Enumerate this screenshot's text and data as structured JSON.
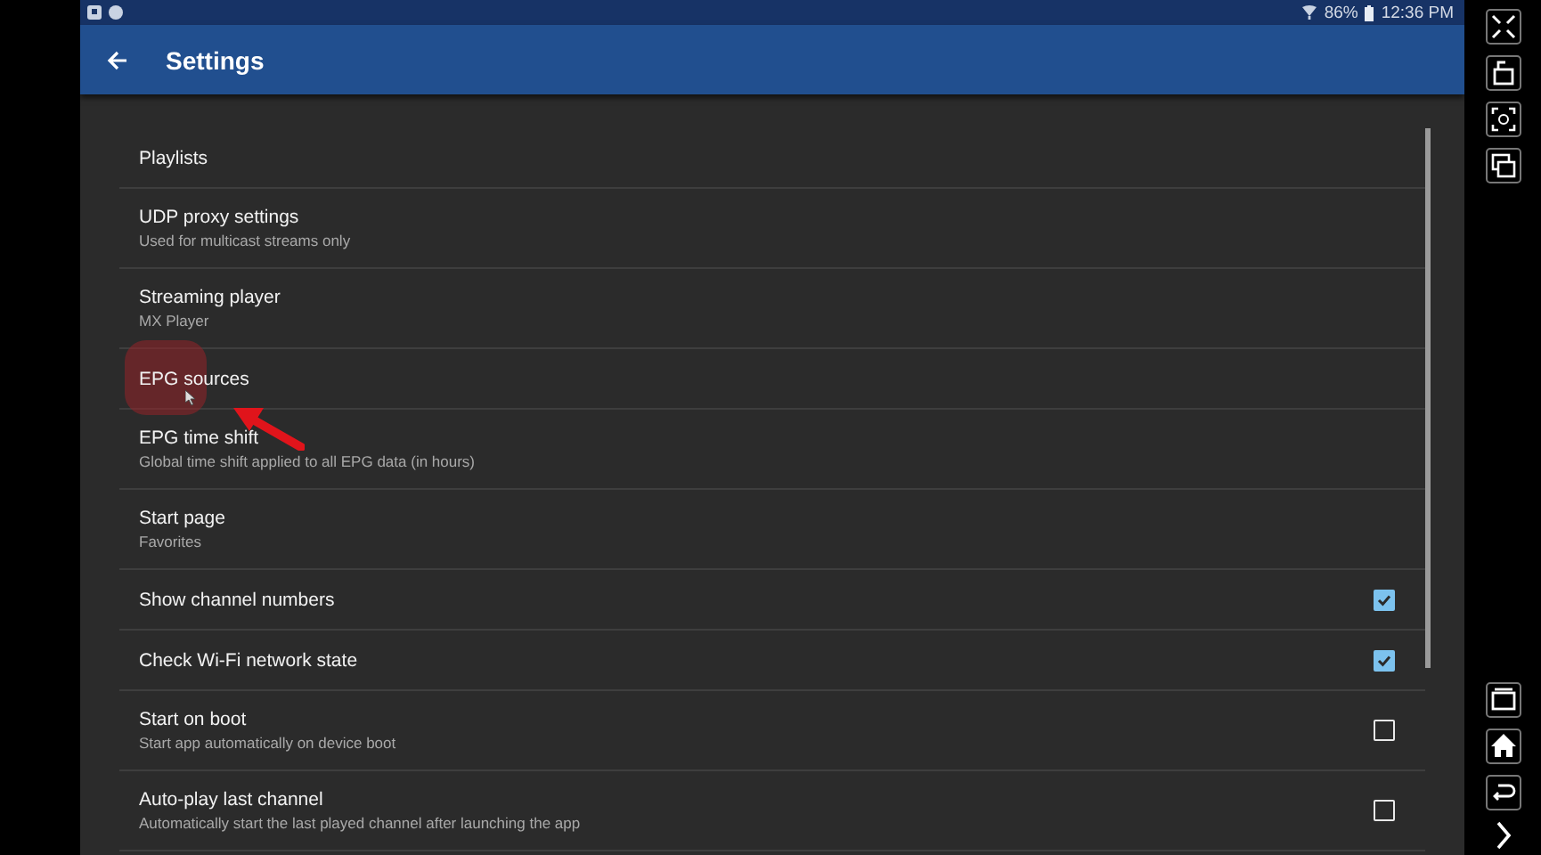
{
  "status_bar": {
    "battery": "86%",
    "time": "12:36 PM"
  },
  "app_bar": {
    "title": "Settings"
  },
  "settings": [
    {
      "title": "Playlists",
      "kind": "plain",
      "pressed": false
    },
    {
      "title": "UDP proxy settings",
      "subtitle": "Used for multicast streams only",
      "kind": "plain",
      "pressed": false
    },
    {
      "title": "Streaming player",
      "subtitle": "MX Player",
      "kind": "plain",
      "pressed": false
    },
    {
      "title": "EPG sources",
      "kind": "plain",
      "pressed": true
    },
    {
      "title": "EPG time shift",
      "subtitle": "Global time shift applied to all EPG data (in hours)",
      "kind": "plain",
      "pressed": false
    },
    {
      "title": "Start page",
      "subtitle": "Favorites",
      "kind": "plain",
      "pressed": false
    },
    {
      "title": "Show channel numbers",
      "kind": "checkbox",
      "checked": true,
      "pressed": false
    },
    {
      "title": "Check Wi-Fi network state",
      "kind": "checkbox",
      "checked": true,
      "pressed": false
    },
    {
      "title": "Start on boot",
      "subtitle": "Start app automatically on device boot",
      "kind": "checkbox",
      "checked": false,
      "pressed": false
    },
    {
      "title": "Auto-play last channel",
      "subtitle": "Automatically start the last played channel after launching the app",
      "kind": "checkbox",
      "checked": false,
      "pressed": false
    }
  ]
}
